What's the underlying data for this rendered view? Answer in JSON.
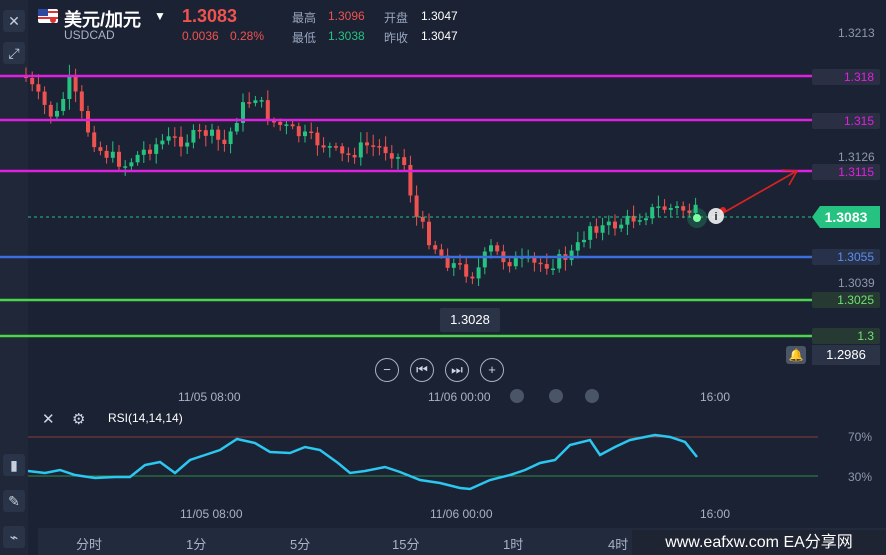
{
  "header": {
    "symbol_cn": "美元/加元",
    "symbol_code": "USDCAD",
    "price": "1.3083",
    "change": "0.0036",
    "change_pct": "0.28%",
    "high_label": "最高",
    "high_value": "1.3096",
    "low_label": "最低",
    "low_value": "1.3038",
    "open_label": "开盘",
    "open_value": "1.3047",
    "prev_close_label": "昨收",
    "prev_close_value": "1.3047"
  },
  "colors": {
    "bg": "#1b2233",
    "bull": "#26c281",
    "bear": "#ef5350",
    "magenta": "#e020e0",
    "blue": "#3b6fe0",
    "green_line": "#4cd44c",
    "rsi_line": "#2cc7f0"
  },
  "price_axis": {
    "ticks": [
      "1.3213",
      "1.3126",
      "1.3039",
      "1.2986"
    ],
    "level_labels": [
      {
        "text": "1.318",
        "color": "#e020e0"
      },
      {
        "text": "1.315",
        "color": "#e020e0"
      },
      {
        "text": "1.3115",
        "color": "#e020e0"
      },
      {
        "text": "1.3083",
        "color": "#26c281"
      },
      {
        "text": "1.3055",
        "color": "#3b6fe0"
      },
      {
        "text": "1.3025",
        "color": "#4cd44c"
      },
      {
        "text": "1.3",
        "color": "#4cd44c"
      }
    ],
    "low_marker": "1.3028",
    "current_label": "1.2986"
  },
  "time_axis": {
    "labels": [
      "11/05 08:00",
      "11/06 00:00",
      "16:00"
    ],
    "rsi_labels": [
      "11/05 08:00",
      "11/06 00:00",
      "16:00"
    ]
  },
  "rsi": {
    "title": "RSI(14,14,14)",
    "upper_label": "70%",
    "lower_label": "30%"
  },
  "timeframes": [
    "分时",
    "1分",
    "5分",
    "15分",
    "1时",
    "4时"
  ],
  "watermark": "www.eafxw.com   EA分享网",
  "icons": {
    "left_close": "close-icon",
    "left_expand": "expand-icon",
    "dropdown": "chevron-down-icon",
    "bell": "bell-icon",
    "rsi_close": "close-icon",
    "rsi_settings": "settings-icon"
  },
  "chart_data": {
    "type": "candlestick",
    "title": "",
    "xlabel": "",
    "ylabel": "",
    "ylim": [
      1.2986,
      1.3213
    ],
    "x_labels": [
      "11/05 08:00",
      "11/06 00:00",
      "16:00"
    ],
    "levels": [
      1.318,
      1.315,
      1.3115,
      1.3055,
      1.3025,
      1.3
    ],
    "last_price": 1.3083
  }
}
